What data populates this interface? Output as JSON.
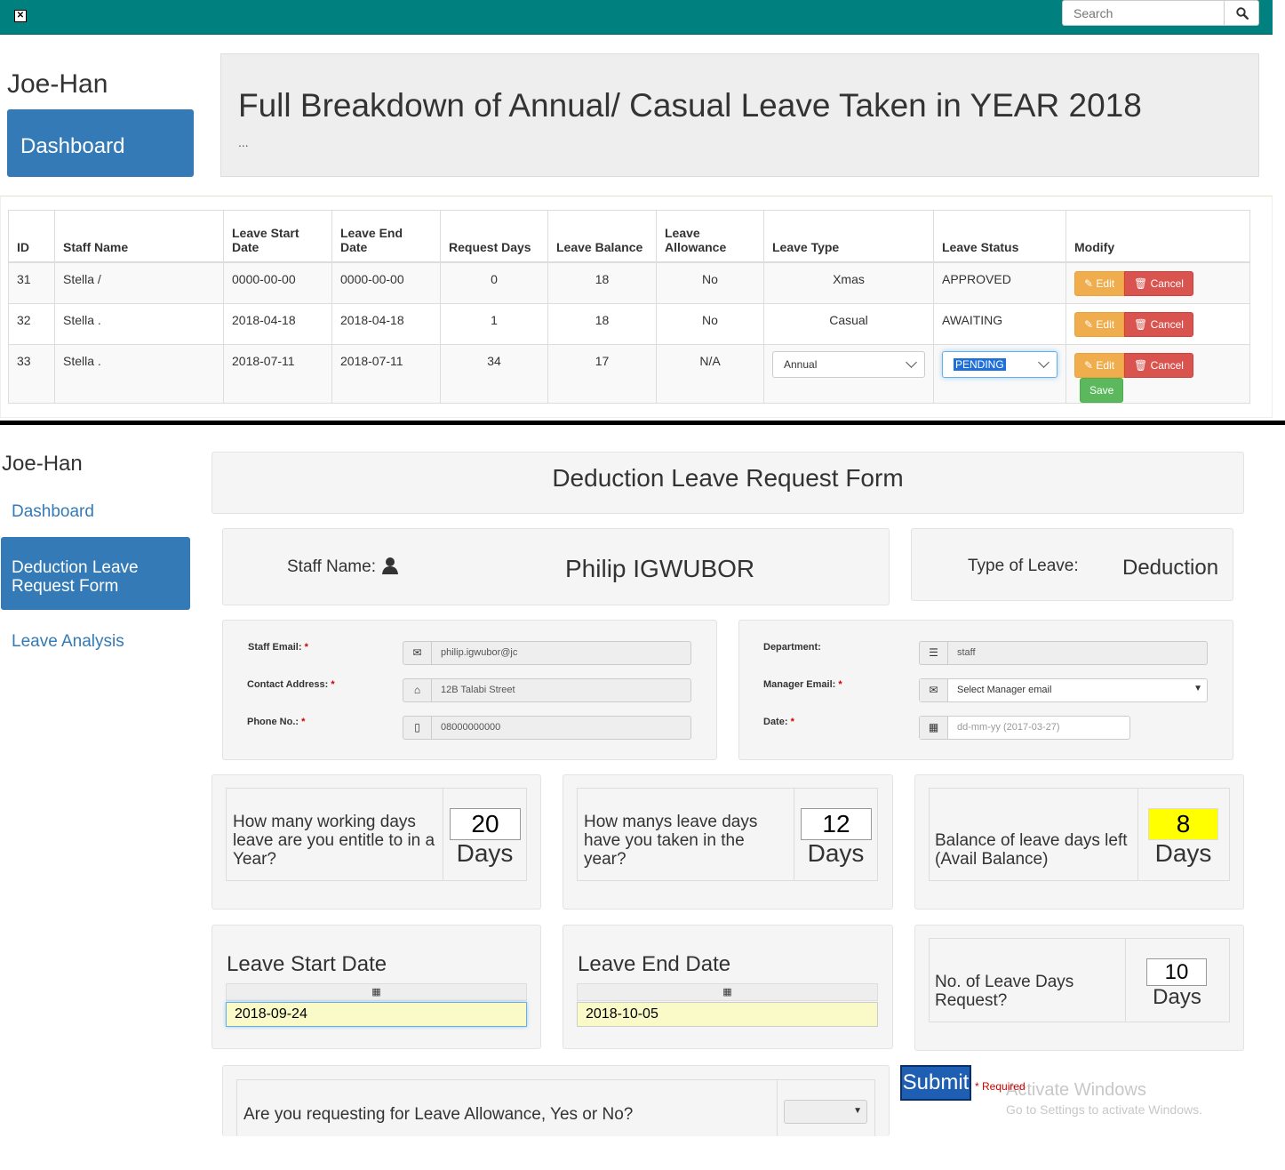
{
  "topbar": {
    "close_glyph": "✕",
    "search_placeholder": "Search"
  },
  "sidebar1": {
    "brand": "Joe-Han",
    "dashboard": "Dashboard"
  },
  "jumbotron": {
    "title": "Full Breakdown of Annual/ Casual Leave Taken in YEAR 2018",
    "subtitle": "..."
  },
  "table": {
    "headers": [
      "ID",
      "Staff Name",
      "Leave Start Date",
      "Leave End Date",
      "Request Days",
      "Leave Balance",
      "Leave Allowance",
      "Leave Type",
      "Leave Status",
      "Modify"
    ],
    "header_lines": {
      "start": [
        "Leave Start",
        "Date"
      ],
      "end": [
        "Leave End",
        "Date"
      ],
      "allow": [
        "Leave",
        "Allowance"
      ]
    },
    "rows": [
      {
        "id": "31",
        "name": "Stella /",
        "start": "0000-00-00",
        "end": "0000-00-00",
        "days": "0",
        "balance": "18",
        "allowance": "No",
        "type": "Xmas",
        "status": "APPROVED"
      },
      {
        "id": "32",
        "name": "Stella .",
        "start": "2018-04-18",
        "end": "2018-04-18",
        "days": "1",
        "balance": "18",
        "allowance": "No",
        "type": "Casual",
        "status": "AWAITING"
      },
      {
        "id": "33",
        "name": "Stella .",
        "start": "2018-07-11",
        "end": "2018-07-11",
        "days": "34",
        "balance": "17",
        "allowance": "N/A",
        "type": "Annual",
        "status": "PENDING"
      }
    ],
    "edit_label": "Edit",
    "cancel_label": "Cancel",
    "save_label": "Save"
  },
  "sidebar2": {
    "brand": "Joe-Han",
    "items": [
      "Dashboard",
      "Deduction Leave Request Form",
      "Leave Analysis"
    ],
    "active_lines": [
      "Deduction Leave",
      "Request Form"
    ]
  },
  "form": {
    "title": "Deduction Leave Request Form",
    "staff_name_label": "Staff Name:",
    "staff_name": "Philip IGWUBOR",
    "type_label": "Type of Leave:",
    "type_value": "Deduction",
    "email_label": "Staff Email:",
    "email_value": "philip.igwubor@jc",
    "address_label": "Contact Address:",
    "address_value": "12B Talabi Street",
    "phone_label": "Phone No.:",
    "phone_value": "08000000000",
    "dept_label": "Department:",
    "dept_value": "staff",
    "manager_label": "Manager Email:",
    "manager_value": "Select Manager email",
    "date_label": "Date:",
    "date_placeholder": "dd-mm-yy (2017-03-27)",
    "req_mark": "*",
    "q_entitled": "How many working days leave are you entitle to in a Year?",
    "entitled_days": "20",
    "q_taken": "How manys leave days have you taken in the year?",
    "taken_days": "12",
    "q_balance": "Balance of leave days left (Avail Balance)",
    "balance_days": "8",
    "days_word": "Days",
    "start_label": "Leave Start Date",
    "start_value": "2018-09-24",
    "end_label": "Leave End Date",
    "end_value": "2018-10-05",
    "q_request": "No. of Leave Days Request?",
    "request_days": "10",
    "q_allowance": "Are you requesting for Leave Allowance, Yes or No?",
    "submit_label": "Submit",
    "required_note": "* Required"
  },
  "watermark": {
    "line1": "Activate Windows",
    "line2": "Go to Settings to activate Windows."
  },
  "colors": {
    "topbar": "#00807f",
    "primary": "#337ab7",
    "edit": "#f0ad4e",
    "cancel": "#d9534f",
    "save": "#5cb85c",
    "highlight": "#ffff00"
  }
}
